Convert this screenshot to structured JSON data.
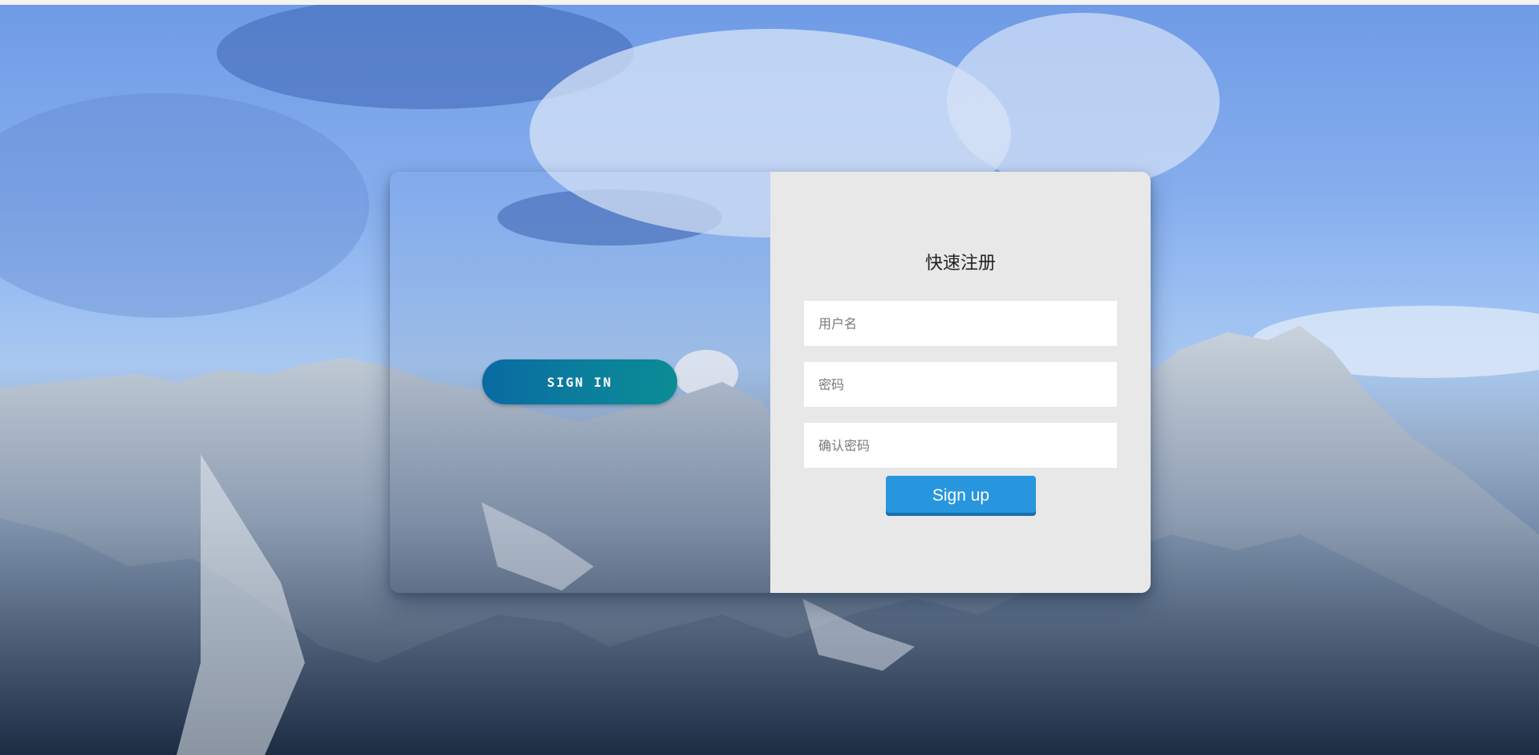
{
  "signin": {
    "button_label": "SIGN IN"
  },
  "signup_form": {
    "title": "快速注册",
    "username_placeholder": "用户名",
    "password_placeholder": "密码",
    "confirm_password_placeholder": "确认密码",
    "submit_label": "Sign up"
  },
  "colors": {
    "signin_gradient_start": "#0a6aa3",
    "signin_gradient_end": "#0a8c95",
    "signup_button": "#2896de",
    "form_panel_bg": "#e8e8e8"
  }
}
